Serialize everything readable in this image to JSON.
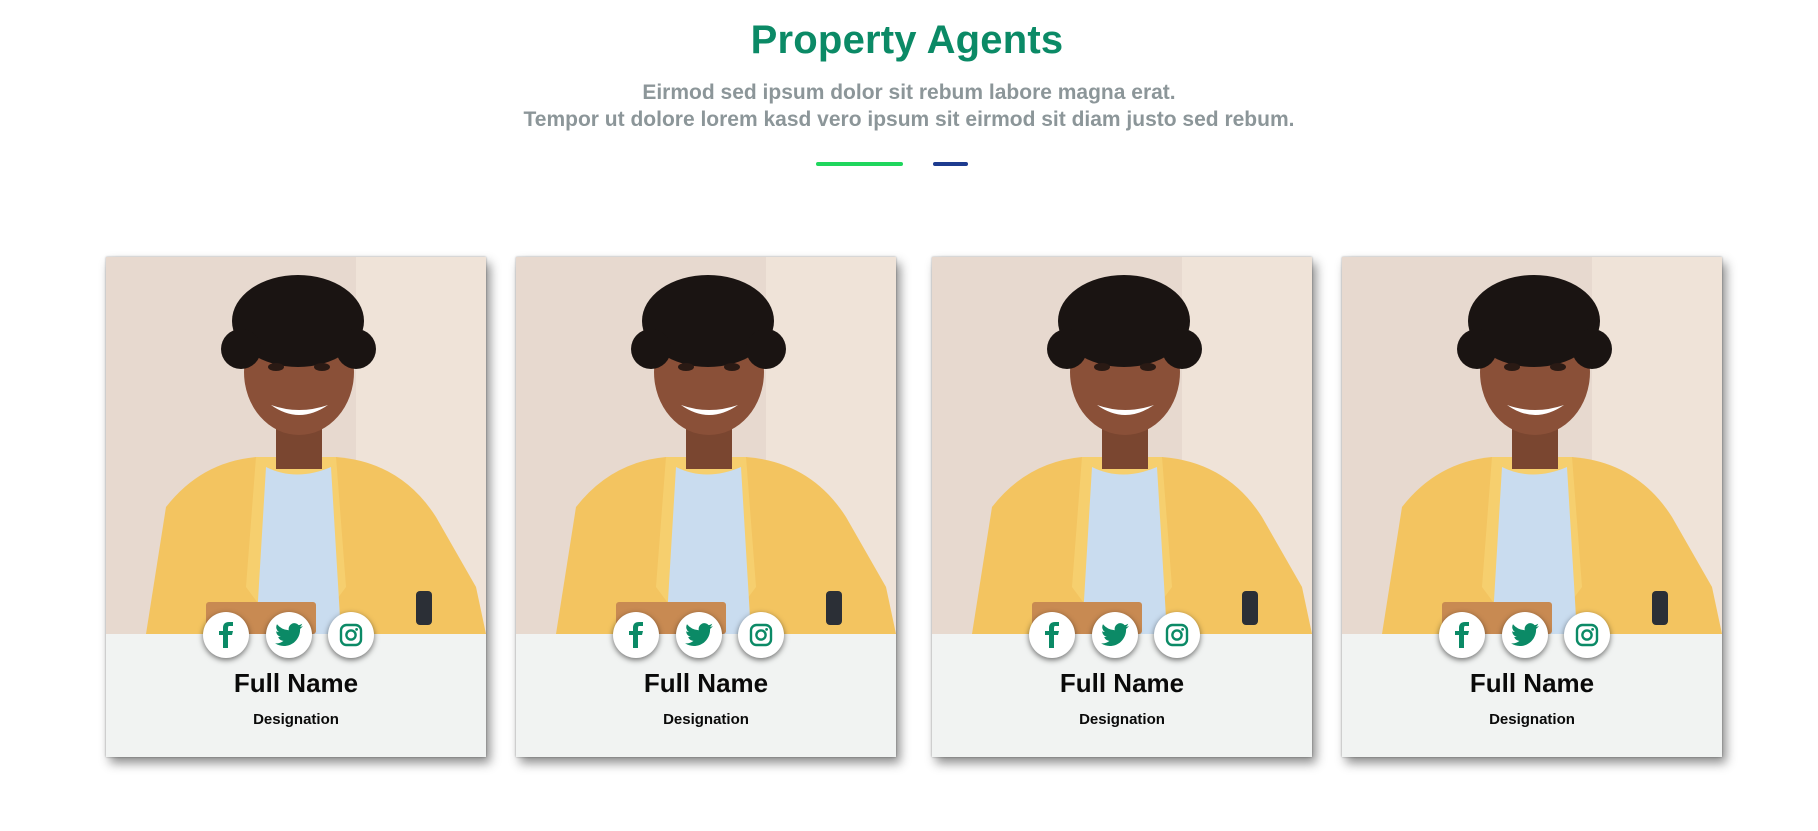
{
  "header": {
    "title": "Property Agents",
    "subtitle_line1": "Eirmod sed ipsum dolor sit rebum labore magna erat.",
    "subtitle_line2": "Tempor ut dolore lorem kasd vero ipsum sit eirmod sit diam justo sed rebum."
  },
  "colors": {
    "accent": "#0b8a66",
    "divider_green": "#1fd65d",
    "divider_blue": "#1d3b8f",
    "subtitle": "#8c9699",
    "card_bg": "#f1f3f2"
  },
  "agents": [
    {
      "name": "Full Name",
      "designation": "Designation",
      "socials": [
        "facebook-icon",
        "twitter-icon",
        "instagram-icon"
      ]
    },
    {
      "name": "Full Name",
      "designation": "Designation",
      "socials": [
        "facebook-icon",
        "twitter-icon",
        "instagram-icon"
      ]
    },
    {
      "name": "Full Name",
      "designation": "Designation",
      "socials": [
        "facebook-icon",
        "twitter-icon",
        "instagram-icon"
      ]
    },
    {
      "name": "Full Name",
      "designation": "Designation",
      "socials": [
        "facebook-icon",
        "twitter-icon",
        "instagram-icon"
      ]
    }
  ]
}
